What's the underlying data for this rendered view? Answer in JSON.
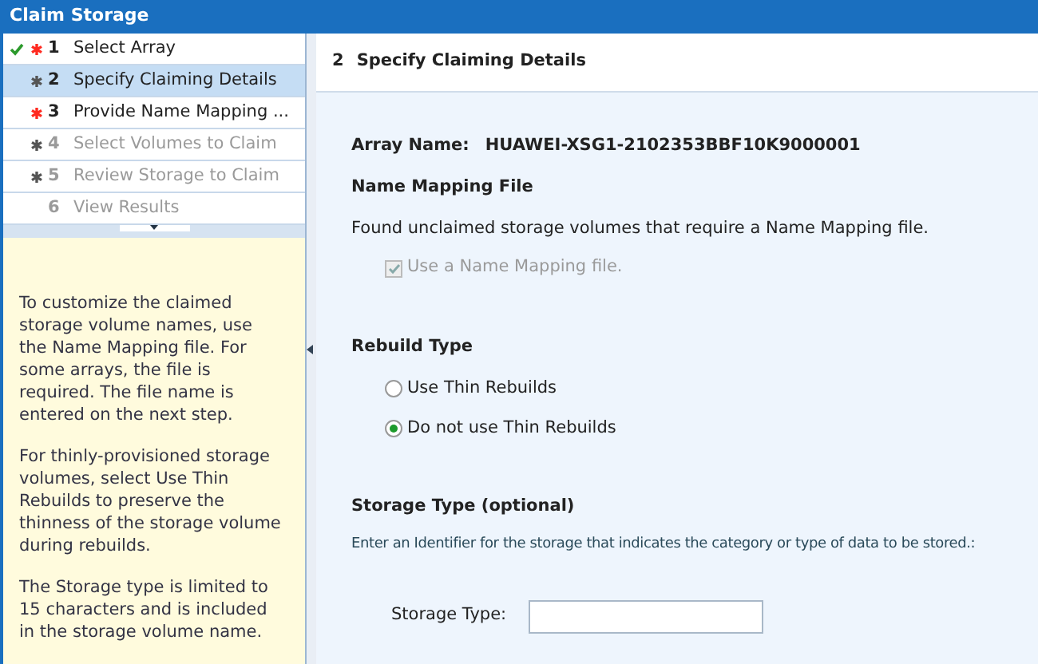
{
  "window": {
    "title": "Claim Storage"
  },
  "steps": [
    {
      "number": "1",
      "label": "Select Array",
      "done": true,
      "required": true,
      "invalid": true,
      "selected": false,
      "disabled": false
    },
    {
      "number": "2",
      "label": "Specify Claiming Details",
      "done": false,
      "required": true,
      "invalid": false,
      "selected": true,
      "disabled": false
    },
    {
      "number": "3",
      "label": "Provide Name Mapping ...",
      "done": false,
      "required": true,
      "invalid": true,
      "selected": false,
      "disabled": false
    },
    {
      "number": "4",
      "label": "Select Volumes to Claim",
      "done": false,
      "required": true,
      "invalid": false,
      "selected": false,
      "disabled": true
    },
    {
      "number": "5",
      "label": "Review Storage to Claim",
      "done": false,
      "required": true,
      "invalid": false,
      "selected": false,
      "disabled": true
    },
    {
      "number": "6",
      "label": "View Results",
      "done": false,
      "required": false,
      "selected": false,
      "disabled": true
    }
  ],
  "help": [
    "To customize the claimed storage volume names, use the Name Mapping file. For some arrays, the file is required. The file name is entered on the next step.",
    "For thinly-provisioned storage volumes, select Use Thin Rebuilds to preserve the thinness of the storage volume during rebuilds.",
    "The Storage type is limited to 15 characters and is included in the storage volume name."
  ],
  "page": {
    "number": "2",
    "title": "Specify Claiming Details",
    "array_label": "Array Name:",
    "array_name": "HUAWEI-XSG1-2102353BBF10K9000001",
    "mapping": {
      "heading": "Name Mapping File",
      "text": "Found unclaimed storage volumes that require a Name Mapping file.",
      "checkbox": {
        "label": "Use a Name Mapping file.",
        "checked": true,
        "disabled": true
      }
    },
    "rebuild": {
      "heading": "Rebuild Type",
      "options": [
        {
          "label": "Use Thin Rebuilds",
          "selected": false
        },
        {
          "label": "Do not use Thin Rebuilds",
          "selected": true
        }
      ]
    },
    "storage_type": {
      "heading": "Storage Type (optional)",
      "text": "Enter an Identifier for the storage that indicates the category or type of data to be stored.:",
      "field_label": "Storage Type:"
    }
  }
}
